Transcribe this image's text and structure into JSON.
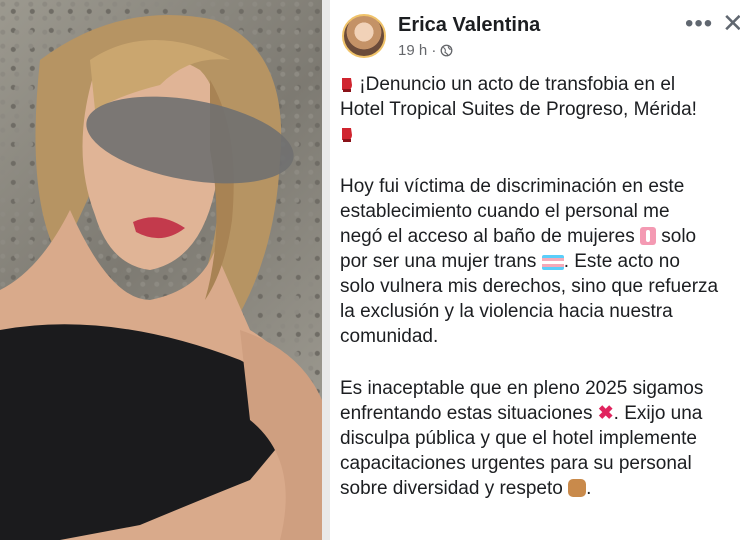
{
  "post": {
    "author": "Erica Valentina",
    "time": "19 h ·",
    "icons": {
      "more": "more-options-icon",
      "close": "close-icon",
      "privacy": "globe-icon"
    },
    "lines": [
      [
        "¡Denuncio un acto de transfobia en el",
        "Hotel Tropical Suites de Progreso, Mérida!"
      ],
      [
        "Hoy fui víctima de discriminación en este",
        "establecimiento cuando el personal me",
        "negó el acceso al baño de mujeres",
        "solo",
        "por ser una mujer trans",
        ". Este acto no",
        "solo vulnera mis derechos, sino que refuerza",
        "la exclusión y la violencia hacia nuestra",
        "comunidad."
      ],
      [
        "Es inaceptable que en pleno 2025 sigamos",
        "enfrentando estas situaciones",
        ". Exijo una",
        "disculpa pública y que el hotel implemente",
        "capacitaciones urgentes para su personal",
        "sobre diversidad y respeto",
        "."
      ]
    ]
  },
  "photo": {
    "description_icon": "photo-image"
  }
}
